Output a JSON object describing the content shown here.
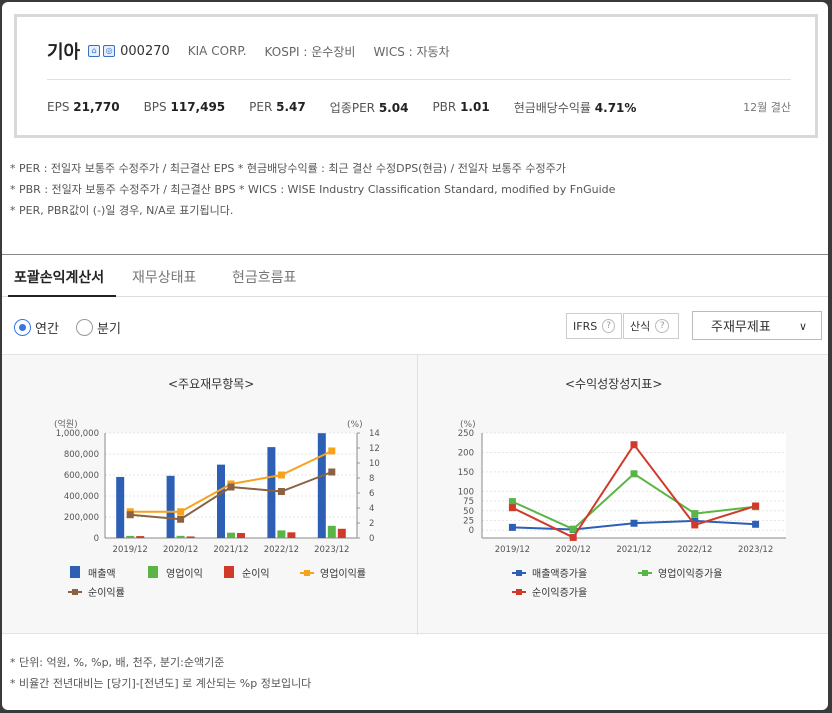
{
  "company": {
    "name": "기아",
    "code": "000270",
    "eng_name": "KIA CORP.",
    "kospi": "KOSPI : 운수장비",
    "wics": "WICS : 자동차"
  },
  "metrics": [
    {
      "label": "EPS",
      "value": "21,770"
    },
    {
      "label": "BPS",
      "value": "117,495"
    },
    {
      "label": "PER",
      "value": "5.47"
    },
    {
      "label": "업종PER",
      "value": "5.04"
    },
    {
      "label": "PBR",
      "value": "1.01"
    },
    {
      "label": "현금배당수익률",
      "value": "4.71%"
    }
  ],
  "settlement": "12월 결산",
  "notes": [
    "* PER : 전일자 보통주 수정주가 / 최근결산 EPS * 현금배당수익률 : 최근 결산 수정DPS(현금) / 전일자 보통주 수정주가",
    "* PBR : 전일자 보통주 수정주가 / 최근결산 BPS * WICS : WISE Industry Classification Standard, modified by FnGuide",
    "* PER, PBR값이 (-)일 경우, N/A로 표기됩니다."
  ],
  "tabs": [
    "포괄손익계산서",
    "재무상태표",
    "현금흐름표"
  ],
  "period": {
    "annual": "연간",
    "quarter": "분기",
    "selected": "annual"
  },
  "buttons": {
    "ifrs": "IFRS",
    "calc": "산식",
    "help": "?"
  },
  "dropdown": {
    "selected": "주재무제표"
  },
  "chart_titles": {
    "left": "<주요재무항목>",
    "right": "<수익성장성지표>"
  },
  "colors": {
    "revenue": "#2d5fb5",
    "op_income": "#5ab546",
    "net_income": "#d03a2b",
    "op_margin": "#f7a21c",
    "net_margin": "#8a6243",
    "rev_growth": "#2d5fb5",
    "op_growth": "#5ab546",
    "net_growth": "#d03a2b"
  },
  "chart_data": [
    {
      "type": "bar",
      "title": "<주요재무항목>",
      "categories": [
        "2019/12",
        "2020/12",
        "2021/12",
        "2022/12",
        "2023/12"
      ],
      "ylabel": "(억원)",
      "y2label": "(%)",
      "ylim": [
        0,
        1000000
      ],
      "y_ticks": [
        "0",
        "200,000",
        "400,000",
        "600,000",
        "800,000",
        "1,000,000"
      ],
      "y2lim": [
        0,
        14
      ],
      "y2_ticks": [
        "0",
        "2",
        "4",
        "6",
        "8",
        "10",
        "12",
        "14"
      ],
      "series": [
        {
          "name": "매출액",
          "axis": "left",
          "kind": "bar",
          "values": [
            581460,
            592168,
            698624,
            865590,
            998084
          ]
        },
        {
          "name": "영업이익",
          "axis": "left",
          "kind": "bar",
          "values": [
            20097,
            20665,
            50657,
            72331,
            116079
          ]
        },
        {
          "name": "순이익",
          "axis": "left",
          "kind": "bar",
          "values": [
            18267,
            14879,
            47600,
            54094,
            87778
          ]
        },
        {
          "name": "영업이익률",
          "axis": "right",
          "kind": "line",
          "values": [
            3.5,
            3.5,
            7.2,
            8.4,
            11.6
          ]
        },
        {
          "name": "순이익률",
          "axis": "right",
          "kind": "line",
          "values": [
            3.1,
            2.5,
            6.8,
            6.2,
            8.8
          ]
        }
      ],
      "legend": "bottom"
    },
    {
      "type": "line",
      "title": "<수익성장성지표>",
      "categories": [
        "2019/12",
        "2020/12",
        "2021/12",
        "2022/12",
        "2023/12"
      ],
      "ylabel": "(%)",
      "ylim": [
        -20,
        250
      ],
      "y_ticks": [
        "0",
        "25",
        "50",
        "75",
        "100",
        "150",
        "200",
        "250"
      ],
      "series": [
        {
          "name": "매출액증가율",
          "values": [
            7.3,
            1.8,
            18.0,
            23.9,
            15.3
          ]
        },
        {
          "name": "영업이익증가율",
          "values": [
            73.6,
            2.8,
            145.1,
            42.8,
            60.5
          ]
        },
        {
          "name": "순이익증가율",
          "values": [
            57.9,
            -18.5,
            219.9,
            13.6,
            62.3
          ]
        }
      ],
      "legend": "bottom"
    }
  ],
  "footnotes": [
    "* 단위: 억원, %, %p, 배, 천주, 분기:순액기준",
    "* 비율간 전년대비는 [당기]-[전년도] 로 계산되는 %p 정보입니다"
  ]
}
